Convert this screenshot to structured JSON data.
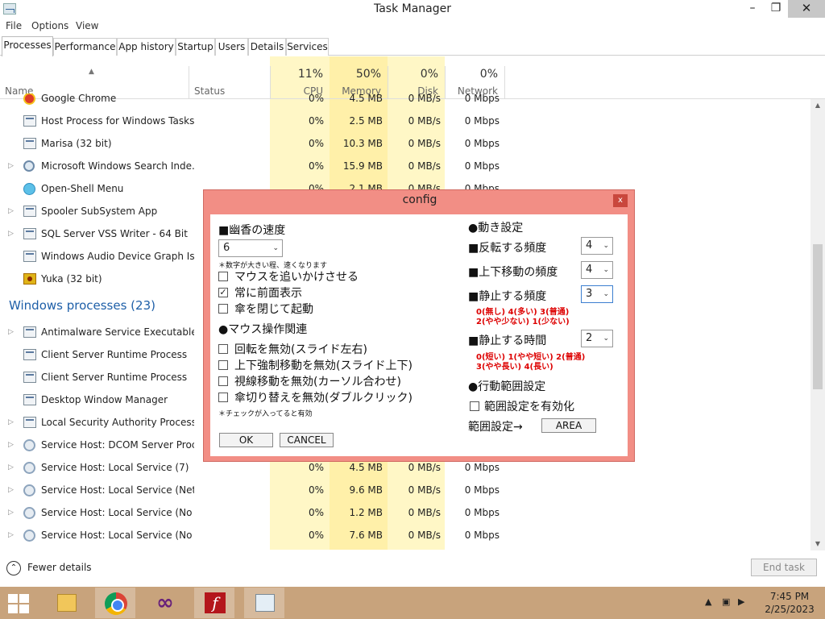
{
  "window": {
    "title": "Task Manager",
    "min": "–",
    "max": "❐",
    "close": "✕"
  },
  "menu": [
    "File",
    "Options",
    "View"
  ],
  "tabs": [
    "Processes",
    "Performance",
    "App history",
    "Startup",
    "Users",
    "Details",
    "Services"
  ],
  "columns": {
    "name": "Name",
    "status": "Status",
    "cpu_pct": "11%",
    "cpu": "CPU",
    "mem_pct": "50%",
    "mem": "Memory",
    "disk_pct": "0%",
    "disk": "Disk",
    "net_pct": "0%",
    "net": "Network"
  },
  "rows": [
    {
      "name": "Google Chrome",
      "cpu": "0%",
      "mem": "4.5 MB",
      "disk": "0 MB/s",
      "net": "0 Mbps",
      "exp": "",
      "icon": "chrome"
    },
    {
      "name": "Host Process for Windows Tasks",
      "cpu": "0%",
      "mem": "2.5 MB",
      "disk": "0 MB/s",
      "net": "0 Mbps",
      "exp": "",
      "icon": "window"
    },
    {
      "name": "Marisa (32 bit)",
      "cpu": "0%",
      "mem": "10.3 MB",
      "disk": "0 MB/s",
      "net": "0 Mbps",
      "exp": "",
      "icon": "window"
    },
    {
      "name": "Microsoft Windows Search Inde...",
      "cpu": "0%",
      "mem": "15.9 MB",
      "disk": "0 MB/s",
      "net": "0 Mbps",
      "exp": "▷",
      "icon": "search"
    },
    {
      "name": "Open-Shell Menu",
      "cpu": "0%",
      "mem": "2.1 MB",
      "disk": "0 MB/s",
      "net": "0 Mbps",
      "exp": "",
      "icon": "shell"
    },
    {
      "name": "Spooler SubSystem App",
      "cpu": "",
      "mem": "",
      "disk": "",
      "net": "",
      "exp": "▷",
      "icon": "window"
    },
    {
      "name": "SQL Server VSS Writer - 64 Bit",
      "cpu": "",
      "mem": "",
      "disk": "",
      "net": "",
      "exp": "▷",
      "icon": "window"
    },
    {
      "name": "Windows Audio Device Graph Is...",
      "cpu": "",
      "mem": "",
      "disk": "",
      "net": "",
      "exp": "",
      "icon": "window"
    },
    {
      "name": "Yuka (32 bit)",
      "cpu": "",
      "mem": "",
      "disk": "",
      "net": "",
      "exp": "",
      "icon": "yuka"
    }
  ],
  "group": "Windows processes (23)",
  "winrows": [
    {
      "name": "Antimalware Service Executable",
      "cpu": "",
      "mem": "",
      "disk": "",
      "net": "",
      "exp": "▷",
      "icon": "window"
    },
    {
      "name": "Client Server Runtime Process",
      "cpu": "",
      "mem": "",
      "disk": "",
      "net": "",
      "exp": "",
      "icon": "window"
    },
    {
      "name": "Client Server Runtime Process",
      "cpu": "",
      "mem": "",
      "disk": "",
      "net": "",
      "exp": "",
      "icon": "window"
    },
    {
      "name": "Desktop Window Manager",
      "cpu": "",
      "mem": "",
      "disk": "",
      "net": "",
      "exp": "",
      "icon": "window"
    },
    {
      "name": "Local Security Authority Process...",
      "cpu": "",
      "mem": "",
      "disk": "",
      "net": "",
      "exp": "▷",
      "icon": "window"
    },
    {
      "name": "Service Host: DCOM Server Proc...",
      "cpu": "",
      "mem": "",
      "disk": "",
      "net": "",
      "exp": "▷",
      "icon": "gear"
    },
    {
      "name": "Service Host: Local Service (7)",
      "cpu": "0%",
      "mem": "4.5 MB",
      "disk": "0 MB/s",
      "net": "0 Mbps",
      "exp": "▷",
      "icon": "gear"
    },
    {
      "name": "Service Host: Local Service (Net...",
      "cpu": "0%",
      "mem": "9.6 MB",
      "disk": "0 MB/s",
      "net": "0 Mbps",
      "exp": "▷",
      "icon": "gear"
    },
    {
      "name": "Service Host: Local Service (No I...",
      "cpu": "0%",
      "mem": "1.2 MB",
      "disk": "0 MB/s",
      "net": "0 Mbps",
      "exp": "▷",
      "icon": "gear"
    },
    {
      "name": "Service Host: Local Service (No ...",
      "cpu": "0%",
      "mem": "7.6 MB",
      "disk": "0 MB/s",
      "net": "0 Mbps",
      "exp": "▷",
      "icon": "gear"
    }
  ],
  "footer": {
    "fewer": "Fewer details",
    "end_task": "End task"
  },
  "taskbar": {
    "time": "7:45 PM",
    "date": "2/25/2023"
  },
  "config": {
    "title": "config",
    "close": "x",
    "speed_label": "■幽香の速度",
    "speed_value": "6",
    "speed_note": "＊数字が大きい程、速くなります",
    "chk_follow": "マウスを追いかけさせる",
    "chk_topmost": "常に前面表示",
    "chk_umbrella": "傘を閉じて起動",
    "mouse_header": "●マウス操作関連",
    "chk_rotate": "回転を無効(スライド左右)",
    "chk_updown": "上下強制移動を無効(スライド上下)",
    "chk_gaze": "視線移動を無効(カーソル合わせ)",
    "chk_switch": "傘切り替えを無効(ダブルクリック)",
    "check_note": "＊チェックが入ってると有効",
    "motion_header": "●動き設定",
    "flip_label": "■反転する頻度",
    "flip_value": "4",
    "vmove_label": "■上下移動の頻度",
    "vmove_value": "4",
    "stop_label": "■静止する頻度",
    "stop_value": "3",
    "stop_note1": "0(無し) 4(多い) 3(普通)",
    "stop_note2": "2(やや少ない) 1(少ない)",
    "stoptime_label": "■静止する時間",
    "stoptime_value": "2",
    "time_note1": "0(短い) 1(やや短い) 2(普通)",
    "time_note2": "3(やや長い) 4(長い)",
    "range_header": "●行動範囲設定",
    "chk_range": "範囲設定を有効化",
    "range_label": "範囲設定→",
    "area_btn": "AREA",
    "ok": "OK",
    "cancel": "CANCEL"
  }
}
